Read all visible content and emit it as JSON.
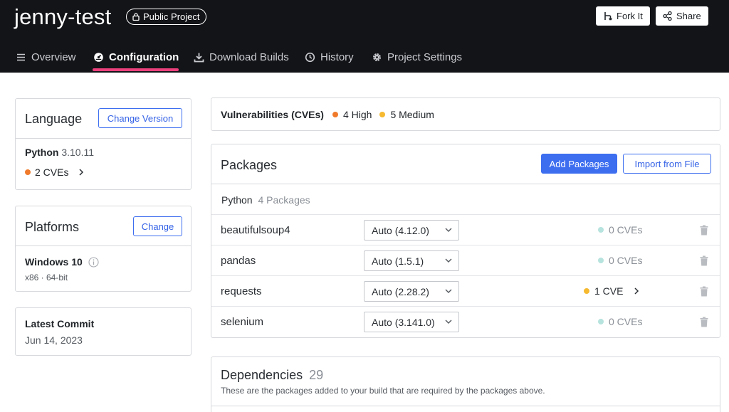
{
  "header": {
    "project_name": "jenny-test",
    "visibility_badge": "Public Project",
    "fork_label": "Fork It",
    "share_label": "Share"
  },
  "tabs": [
    {
      "label": "Overview",
      "icon": "list-icon",
      "active": false
    },
    {
      "label": "Configuration",
      "icon": "gauge-icon",
      "active": true
    },
    {
      "label": "Download Builds",
      "icon": "download-icon",
      "active": false
    },
    {
      "label": "History",
      "icon": "history-icon",
      "active": false
    },
    {
      "label": "Project Settings",
      "icon": "gear-icon",
      "active": false
    }
  ],
  "language": {
    "title": "Language",
    "change_label": "Change Version",
    "name": "Python",
    "version": "3.10.11",
    "cves": "2 CVEs"
  },
  "platforms": {
    "title": "Platforms",
    "change_label": "Change",
    "os": "Windows 10",
    "arch": "x86 · 64-bit"
  },
  "latest_commit": {
    "title": "Latest Commit",
    "date": "Jun 14, 2023"
  },
  "vulnerabilities": {
    "label": "Vulnerabilities (CVEs)",
    "high": "4 High",
    "medium": "5 Medium"
  },
  "packages": {
    "title": "Packages",
    "add_label": "Add Packages",
    "import_label": "Import from File",
    "group_name": "Python",
    "group_count": "4 Packages",
    "rows": [
      {
        "name": "beautifulsoup4",
        "version": "Auto (4.12.0)",
        "cves": "0 CVEs",
        "severity": "none"
      },
      {
        "name": "pandas",
        "version": "Auto (1.5.1)",
        "cves": "0 CVEs",
        "severity": "none"
      },
      {
        "name": "requests",
        "version": "Auto (2.28.2)",
        "cves": "1 CVE",
        "severity": "medium"
      },
      {
        "name": "selenium",
        "version": "Auto (3.141.0)",
        "cves": "0 CVEs",
        "severity": "none"
      }
    ]
  },
  "dependencies": {
    "title": "Dependencies",
    "count": "29",
    "description": "These are the packages added to your build that are required by the packages above."
  },
  "colors": {
    "header_bg": "#131418",
    "accent_pink": "#ec3f7c",
    "primary_blue": "#3d6ef0",
    "high": "#f07a2b",
    "medium": "#f6b92f",
    "none": "#b7e3de"
  }
}
